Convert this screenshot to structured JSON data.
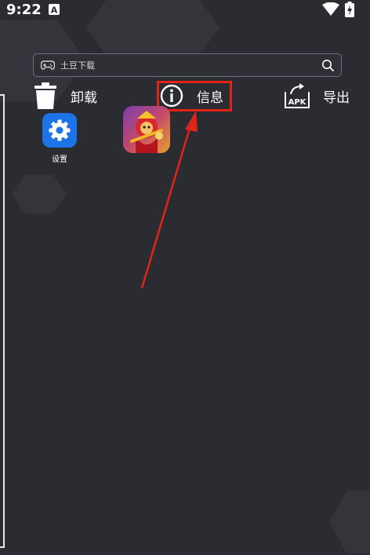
{
  "status_bar": {
    "time": "9:22",
    "notification_icon": "a-letter-icon",
    "wifi_icon": "wifi-icon",
    "battery_icon": "battery-charging-icon"
  },
  "search": {
    "placeholder": "土豆下载",
    "left_icon": "gamepad-icon",
    "right_icon": "search-icon"
  },
  "actions": {
    "uninstall": {
      "label": "卸载",
      "icon": "trash-icon"
    },
    "info": {
      "label": "信息",
      "icon": "info-icon"
    },
    "export": {
      "label": "导出",
      "icon": "apk-export-icon"
    }
  },
  "apps": [
    {
      "label": "设置",
      "icon": "gear-icon"
    },
    {
      "label": "",
      "icon": "game-monkey-icon"
    }
  ],
  "annotation": {
    "highlight_color": "#e2231a",
    "arrow_color": "#e2231a"
  },
  "colors": {
    "background": "#2b2c31",
    "accent_blue": "#1d74e8"
  }
}
